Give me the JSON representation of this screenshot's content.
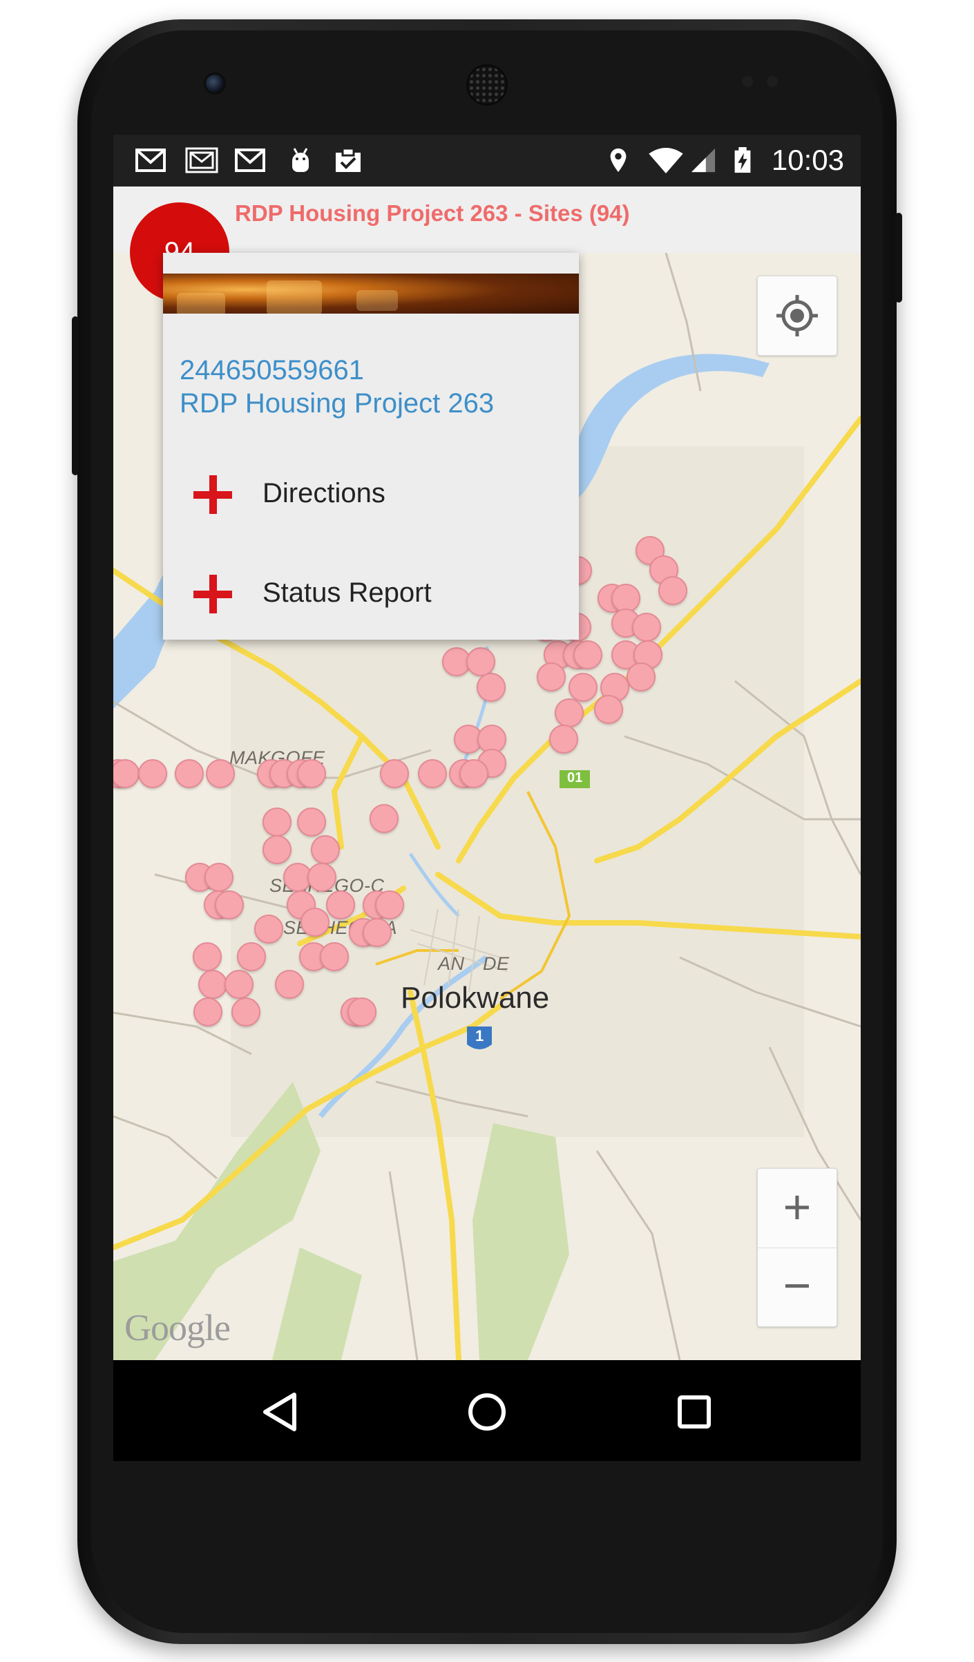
{
  "status_bar": {
    "time": "10:03",
    "left_icons": [
      "gmail-icon",
      "gmail-icon",
      "gmail-icon",
      "android-debug-icon",
      "clipboard-check-icon"
    ],
    "right_icons": [
      "location-icon",
      "wifi-icon",
      "signal-icon",
      "battery-charging-icon"
    ]
  },
  "action_bar": {
    "title": "RDP Housing Project 263 - Sites (94)",
    "title_color": "#ef6b6b",
    "badge_count": "94",
    "badge_color": "#d40c0c"
  },
  "popup": {
    "site_id": "244650559661",
    "project_name": "RDP Housing Project 263",
    "actions": [
      {
        "label": "Directions",
        "icon": "red-plus-icon"
      },
      {
        "label": "Status Report",
        "icon": "red-plus-icon"
      }
    ]
  },
  "map": {
    "place_labels": [
      "MAKGOFE",
      "SESHEGO-C",
      "SESHEGO-A",
      "AN",
      "DE"
    ],
    "city_label": "Polokwane",
    "road_shields": [
      "01",
      "1"
    ],
    "attribution": "Google",
    "marker_color": "#f7a6ae",
    "controls": {
      "my_location": "my-location-icon",
      "zoom_in": "+",
      "zoom_out": "−"
    }
  },
  "nav_bar": {
    "icons": [
      "back-icon",
      "home-icon",
      "recents-icon"
    ]
  }
}
